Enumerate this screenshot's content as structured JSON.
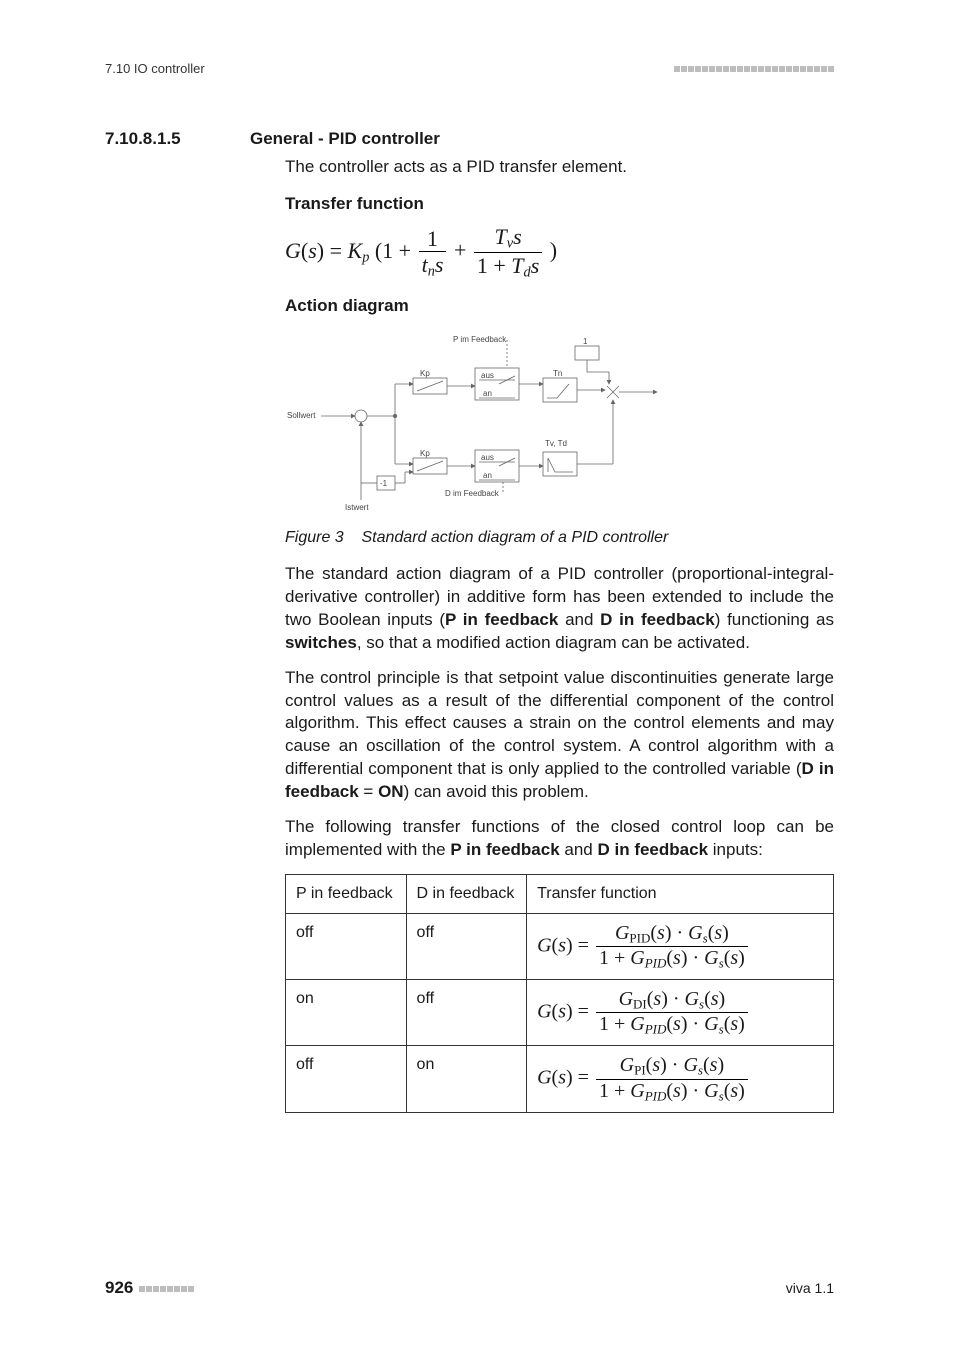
{
  "header": {
    "left": "7.10 IO controller"
  },
  "section": {
    "number": "7.10.8.1.5",
    "title": "General - PID controller"
  },
  "intro": "The controller acts as a PID transfer element.",
  "subheads": {
    "transfer": "Transfer function",
    "action": "Action diagram"
  },
  "figure": {
    "label": "Figure 3",
    "caption": "Standard action diagram of a PID controller"
  },
  "diagram_labels": {
    "p_feedback": "P im Feedback",
    "d_feedback": "D im Feedback",
    "sollwert": "Sollwert",
    "istwert": "Istwert",
    "kp": "Kp",
    "tn": "Tn",
    "tvtd": "Tv, Td",
    "aus": "aus",
    "an": "an",
    "minus1": "-1",
    "one": "1"
  },
  "para1_parts": {
    "a": "The standard action diagram of a PID controller (proportional-integral-derivative controller) in additive form has been extended to include the two Boolean inputs (",
    "b": "P in feedback",
    "c": " and ",
    "d": "D in feedback",
    "e": ") functioning as ",
    "f": "switches",
    "g": ", so that a modified action diagram can be activated."
  },
  "para2_parts": {
    "a": "The control principle is that setpoint value discontinuities generate large control values as a result of the differential component of the control algorithm. This effect causes a strain on the control elements and may cause an oscillation of the control system. A control algorithm with a differential component that is only applied to the controlled variable (",
    "b": "D in feedback",
    "c": " = ",
    "d": "ON",
    "e": ") can avoid this problem."
  },
  "para3_parts": {
    "a": "The following transfer functions of the closed control loop can be implemented with the ",
    "b": "P in feedback",
    "c": " and ",
    "d": "D in feedback",
    "e": " inputs:"
  },
  "table": {
    "headers": [
      "P in feedback",
      "D in feedback",
      "Transfer function"
    ],
    "rows": [
      {
        "p": "off",
        "d": "off",
        "num_sub": "PID"
      },
      {
        "p": "on",
        "d": "off",
        "num_sub": "DI"
      },
      {
        "p": "off",
        "d": "on",
        "num_sub": "PI"
      }
    ]
  },
  "footer": {
    "page": "926",
    "right": "viva 1.1"
  },
  "chart_data": {
    "type": "diagram",
    "description": "Block diagram of a PID controller in additive form with switchable P-in-feedback and D-in-feedback paths.",
    "nodes": [
      {
        "id": "sollwert",
        "label": "Sollwert",
        "role": "input-setpoint"
      },
      {
        "id": "istwert",
        "label": "Istwert",
        "role": "input-actual"
      },
      {
        "id": "sum1",
        "role": "summing-junction",
        "inputs": [
          "sollwert(+)",
          "istwert(-)"
        ]
      },
      {
        "id": "kp_p",
        "label": "Kp",
        "role": "gain",
        "path": "P"
      },
      {
        "id": "sw_p",
        "label": "P im Feedback aus/an",
        "role": "switch",
        "path": "P"
      },
      {
        "id": "tn",
        "label": "Tn",
        "role": "integrator",
        "symbol": "ramp"
      },
      {
        "id": "kp_d",
        "label": "Kp",
        "role": "gain",
        "path": "D"
      },
      {
        "id": "sw_d",
        "label": "D im Feedback aus/an",
        "role": "switch",
        "path": "D"
      },
      {
        "id": "tvtd",
        "label": "Tv, Td",
        "role": "derivative",
        "symbol": "step-decay"
      },
      {
        "id": "neg1",
        "label": "-1",
        "role": "gain"
      },
      {
        "id": "one",
        "label": "1",
        "role": "constant"
      },
      {
        "id": "sum_out",
        "role": "summing-junction"
      },
      {
        "id": "output",
        "role": "output"
      }
    ],
    "edges": [
      [
        "sollwert",
        "sum1"
      ],
      [
        "istwert",
        "sum1"
      ],
      [
        "sum1",
        "kp_p"
      ],
      [
        "kp_p",
        "sw_p"
      ],
      [
        "sw_p",
        "tn"
      ],
      [
        "tn",
        "sum_out"
      ],
      [
        "sum1",
        "kp_d"
      ],
      [
        "istwert",
        "neg1"
      ],
      [
        "neg1",
        "kp_d"
      ],
      [
        "kp_d",
        "sw_d"
      ],
      [
        "sw_d",
        "tvtd"
      ],
      [
        "tvtd",
        "sum_out"
      ],
      [
        "one",
        "sum_out"
      ],
      [
        "sum_out",
        "output"
      ]
    ],
    "switch_inputs": {
      "P_in_feedback": [
        "aus",
        "an"
      ],
      "D_in_feedback": [
        "aus",
        "an"
      ]
    }
  }
}
